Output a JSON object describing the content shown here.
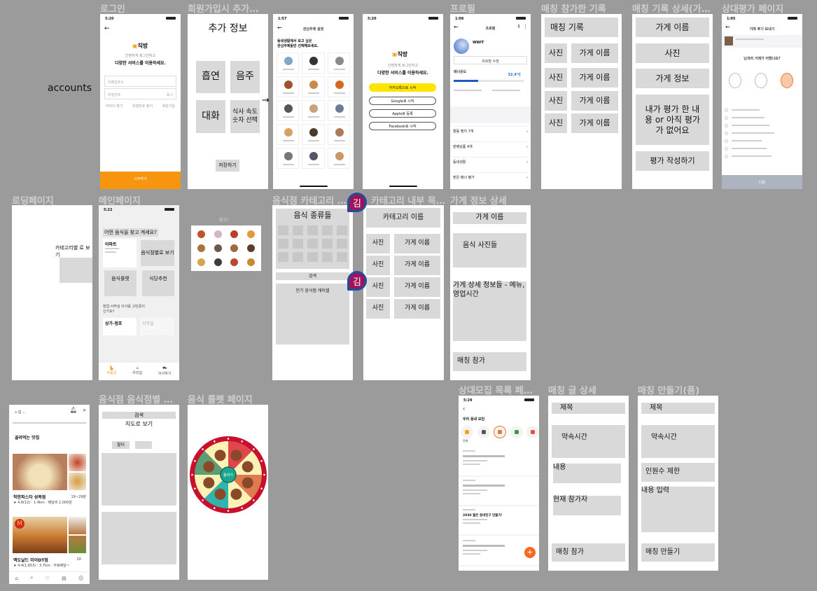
{
  "canvas": {
    "section_label": "accounts",
    "accent": "#ff9500",
    "comment_avatar": "김"
  },
  "frames": {
    "login": {
      "title": "로그인",
      "time": "5:20",
      "logo": "직방",
      "line1": "간편하게 로그인하고",
      "line2": "다양한 서비스를 이용하세요.",
      "email_placeholder": "이메일주소",
      "password_placeholder": "비밀번호",
      "show_label": "표시",
      "links": [
        "아이디 찾기",
        "비밀번호 찾기",
        "회원가입"
      ],
      "start": "시작하기"
    },
    "signup_extra": {
      "title": "회원가입시 추가…",
      "heading": "추가 정보",
      "options": [
        "흡연",
        "음주",
        "대화"
      ],
      "speed_line1": "식사 속도",
      "speed_line2": "숫자 선택",
      "save": "저장하기",
      "arrow": "→"
    },
    "interest": {
      "time": "1:57",
      "header": "관심주제 설정",
      "line1": "동네생활에서 보고 싶은",
      "line2": "관심주제들만 선택해보세요."
    },
    "social_login": {
      "time": "5:20",
      "logo": "직방",
      "line1": "간편하게 로그인하고",
      "line2": "다양한 서비스를 이용하세요.",
      "buttons": [
        "카카오톡으로 시작",
        "Google로 시작",
        "Apple로 등록",
        "Facebook로 시작"
      ]
    },
    "profile": {
      "title": "프로필",
      "time": "1:06",
      "header": "프로필",
      "name": "WWIT",
      "edit": "프로필 수정",
      "manner": "매너온도",
      "temp": "32.4°C",
      "temp_fill": 0.35,
      "menu": [
        "활동 뱃지 7개",
        "판매상품 4개",
        "동네생활",
        "받은 매너 평가"
      ]
    },
    "match_history": {
      "title": "매칭 참가한 기록",
      "heading": "매칭 기록",
      "photo": "사진",
      "store": "가게 이름"
    },
    "match_detail_record": {
      "title": "매칭 기록 상세(가…",
      "store": "가게 이름",
      "photo": "사진",
      "info": "가게 정보",
      "review": "내가 평가 한 내용 or 아직 평가 가 없어요",
      "write": "평가 작성하기"
    },
    "review": {
      "title": "상대평가 페이지",
      "time": "1:05",
      "header": "거래 후기 보내기",
      "question": "님과의 거래가 어땠나요?",
      "next": "다음"
    },
    "loading": {
      "title": "로딩페이지",
      "text": "카테고리별 로 보기"
    },
    "main": {
      "title": "메인페이지",
      "time": "5:22",
      "question": "어떤 음식을 찾고 계세요?",
      "apt": "아파트",
      "cards": [
        "음식점별로 보기",
        "음식룰렛",
        "식당추천"
      ],
      "office_q": "창업·사무실 이사를 고민중이신가요?",
      "shop": "상가·점포",
      "office": "사무실",
      "nav": [
        "부동산",
        "우리집",
        "이사하기"
      ]
    },
    "reference": {
      "title": "참고!"
    },
    "category": {
      "title": "음식점 카테고리 …",
      "kinds": "음식 종류들",
      "search": "검색",
      "carousel": "인기 음식점 캐러셀"
    },
    "category_list": {
      "title": "카테고리 내부 목…",
      "heading": "카테고리 이름",
      "photo": "사진",
      "store": "가게 이름"
    },
    "store_detail": {
      "title": "가게 정보 상세",
      "store": "가게 이름",
      "photos": "음식 사진들",
      "details": "가게 상세 정보들 - 메뉴, 영업시간",
      "join": "매칭 참가"
    },
    "delivery_ref": {
      "location": "집",
      "section": "골라먹는 맛집",
      "store1": "착한파스타 성북점",
      "time1": "19~29분",
      "meta1": "★ 4.8(12) · 1.4km · 배달비 2,000원",
      "store2": "맥도날드 미아DT점",
      "meta2": "★ 4.4(1,653) · 3.7km · 무료배달~",
      "time2": "20"
    },
    "store_by_food": {
      "title": "음식점 음식점별 …",
      "search": "검색",
      "map": "지도로 보기",
      "filter": "필터"
    },
    "roulette": {
      "title": "음식 룰렛 페이지",
      "spin": "돌리기",
      "colors": [
        "#e0474c",
        "#fbf3b5",
        "#e07a4f",
        "#fbf3b5",
        "#2fb4ae",
        "#fbf3b5",
        "#5b9e74",
        "#fbf3b5"
      ]
    },
    "recruit_list": {
      "title": "상대모집 목록 페…",
      "time": "5:29",
      "header": "우리 동네 모임",
      "cat_first": "전체",
      "post3": "2030 젊은 동네친구 만들기!"
    },
    "match_post": {
      "title": "매칭 글 상세",
      "subject": "제목",
      "time": "약속시간",
      "content": "내용",
      "participants": "현재 참가자",
      "join": "매칭 참가"
    },
    "match_create": {
      "title": "매칭 만들기(폼)",
      "subject": "제목",
      "time": "약속시간",
      "limit": "인원수 제한",
      "content": "내용 입력",
      "create": "매칭 만들기"
    }
  }
}
